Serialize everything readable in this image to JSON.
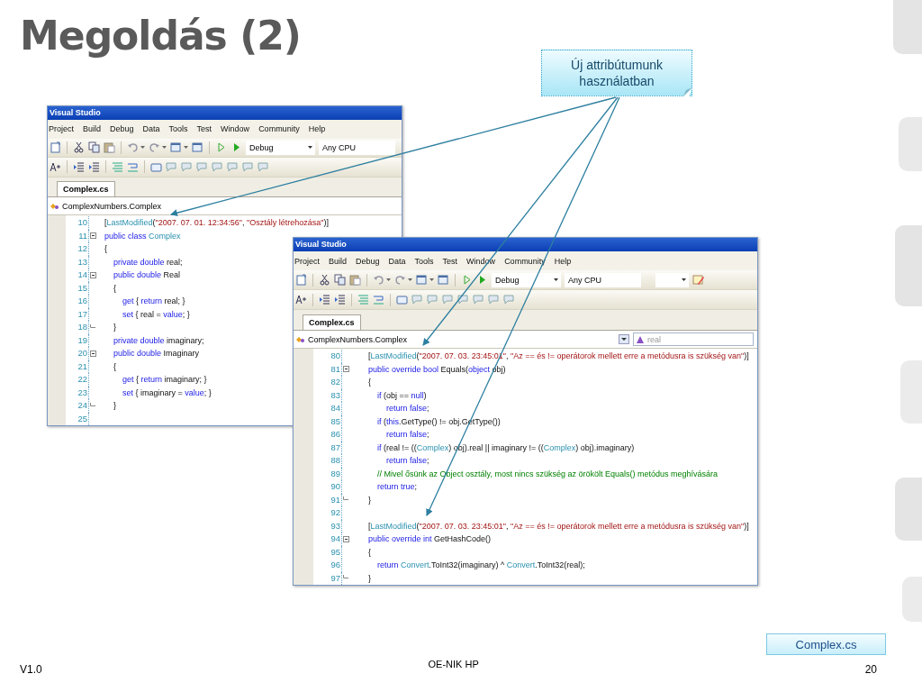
{
  "slide": {
    "title": "Megoldás (2)",
    "callout": "Új attribútumunk használatban"
  },
  "windows": [
    {
      "title": "Visual Studio",
      "menu": [
        "Project",
        "Build",
        "Debug",
        "Data",
        "Tools",
        "Test",
        "Window",
        "Community",
        "Help"
      ],
      "configuration": "Debug",
      "platform": "Any CPU",
      "extra_combo": false,
      "tab": {
        "label": "Complex.cs",
        "selected": true
      },
      "navigation": "ComplexNumbers.Complex",
      "lines": [
        {
          "number": "10",
          "kind": "plain",
          "tokens": [
            {
              "kind": "txt",
              "t": "["
            },
            {
              "kind": "type",
              "t": "LastModified"
            },
            {
              "kind": "txt",
              "t": "("
            },
            {
              "kind": "str",
              "t": "\"2007. 07. 01. 12:34:56\""
            },
            {
              "kind": "txt",
              "t": ", "
            },
            {
              "kind": "str",
              "t": "\"Osztály létrehozása\""
            },
            {
              "kind": "txt",
              "t": ")]"
            }
          ]
        },
        {
          "number": "11",
          "kind": "start",
          "tokens": [
            {
              "kind": "kw",
              "t": "public class "
            },
            {
              "kind": "type",
              "t": "Complex"
            }
          ]
        },
        {
          "number": "12",
          "kind": "plain",
          "tokens": [
            {
              "kind": "txt",
              "t": "{"
            }
          ]
        },
        {
          "number": "13",
          "kind": "plain",
          "tokens": [
            {
              "kind": "kw",
              "t": "    private double "
            },
            {
              "kind": "txt",
              "t": "real;"
            }
          ]
        },
        {
          "number": "14",
          "kind": "start",
          "tokens": [
            {
              "kind": "kw",
              "t": "    public double "
            },
            {
              "kind": "txt",
              "t": "Real"
            }
          ]
        },
        {
          "number": "15",
          "kind": "plain",
          "tokens": [
            {
              "kind": "txt",
              "t": "    {"
            }
          ]
        },
        {
          "number": "16",
          "kind": "plain",
          "tokens": [
            {
              "kind": "kw",
              "t": "        get "
            },
            {
              "kind": "txt",
              "t": "{ "
            },
            {
              "kind": "kw",
              "t": "return "
            },
            {
              "kind": "txt",
              "t": "real; }"
            }
          ]
        },
        {
          "number": "17",
          "kind": "plain",
          "tokens": [
            {
              "kind": "kw",
              "t": "        set "
            },
            {
              "kind": "txt",
              "t": "{ real = "
            },
            {
              "kind": "kw",
              "t": "value"
            },
            {
              "kind": "txt",
              "t": "; }"
            }
          ]
        },
        {
          "number": "18",
          "kind": "end",
          "tokens": [
            {
              "kind": "txt",
              "t": "    }"
            }
          ]
        },
        {
          "number": "19",
          "kind": "plain",
          "tokens": [
            {
              "kind": "kw",
              "t": "    private double "
            },
            {
              "kind": "txt",
              "t": "imaginary;"
            }
          ]
        },
        {
          "number": "20",
          "kind": "start",
          "tokens": [
            {
              "kind": "kw",
              "t": "    public double "
            },
            {
              "kind": "txt",
              "t": "Imaginary"
            }
          ]
        },
        {
          "number": "21",
          "kind": "plain",
          "tokens": [
            {
              "kind": "txt",
              "t": "    {"
            }
          ]
        },
        {
          "number": "22",
          "kind": "plain",
          "tokens": [
            {
              "kind": "kw",
              "t": "        get "
            },
            {
              "kind": "txt",
              "t": "{ "
            },
            {
              "kind": "kw",
              "t": "return "
            },
            {
              "kind": "txt",
              "t": "imaginary; }"
            }
          ]
        },
        {
          "number": "23",
          "kind": "plain",
          "tokens": [
            {
              "kind": "kw",
              "t": "        set "
            },
            {
              "kind": "txt",
              "t": "{ imaginary = "
            },
            {
              "kind": "kw",
              "t": "value"
            },
            {
              "kind": "txt",
              "t": "; }"
            }
          ]
        },
        {
          "number": "24",
          "kind": "end",
          "tokens": [
            {
              "kind": "txt",
              "t": "    }"
            }
          ]
        },
        {
          "number": "25",
          "kind": "plain"
        }
      ]
    },
    {
      "title": "Visual Studio",
      "menu": [
        "Project",
        "Build",
        "Debug",
        "Data",
        "Tools",
        "Test",
        "Window",
        "Community",
        "Help"
      ],
      "configuration": "Debug",
      "platform": "Any CPU",
      "extra_combo": true,
      "tab": {
        "label": "Complex.cs",
        "selected": true
      },
      "navigation": "ComplexNumbers.Complex",
      "member": "real",
      "lines": [
        {
          "number": "80",
          "kind": "plain",
          "tokens": [
            {
              "kind": "txt",
              "t": "["
            },
            {
              "kind": "type",
              "t": "LastModified"
            },
            {
              "kind": "txt",
              "t": "("
            },
            {
              "kind": "str",
              "t": "\"2007. 07. 03. 23:45:01\""
            },
            {
              "kind": "txt",
              "t": ", "
            },
            {
              "kind": "str",
              "t": "\"Az == és != operátorok mellett erre a metódusra is szükség van\""
            },
            {
              "kind": "txt",
              "t": ")]"
            }
          ]
        },
        {
          "number": "81",
          "kind": "start",
          "tokens": [
            {
              "kind": "kw",
              "t": "public override bool "
            },
            {
              "kind": "txt",
              "t": "Equals("
            },
            {
              "kind": "kw",
              "t": "object "
            },
            {
              "kind": "txt",
              "t": "obj)"
            }
          ]
        },
        {
          "number": "82",
          "kind": "plain",
          "tokens": [
            {
              "kind": "txt",
              "t": "{"
            }
          ]
        },
        {
          "number": "83",
          "kind": "plain",
          "tokens": [
            {
              "kind": "kw",
              "t": "    if "
            },
            {
              "kind": "txt",
              "t": "(obj == "
            },
            {
              "kind": "kw",
              "t": "null"
            },
            {
              "kind": "txt",
              "t": ")"
            }
          ]
        },
        {
          "number": "84",
          "kind": "plain",
          "tokens": [
            {
              "kind": "kw",
              "t": "        return false"
            },
            {
              "kind": "txt",
              "t": ";"
            }
          ]
        },
        {
          "number": "85",
          "kind": "plain",
          "tokens": [
            {
              "kind": "kw",
              "t": "    if "
            },
            {
              "kind": "txt",
              "t": "("
            },
            {
              "kind": "kw",
              "t": "this"
            },
            {
              "kind": "txt",
              "t": ".GetType() != obj.GetType())"
            }
          ]
        },
        {
          "number": "86",
          "kind": "plain",
          "tokens": [
            {
              "kind": "kw",
              "t": "        return false"
            },
            {
              "kind": "txt",
              "t": ";"
            }
          ]
        },
        {
          "number": "87",
          "kind": "plain",
          "tokens": [
            {
              "kind": "kw",
              "t": "    if "
            },
            {
              "kind": "txt",
              "t": "(real != (("
            },
            {
              "kind": "type",
              "t": "Complex"
            },
            {
              "kind": "txt",
              "t": ") obj).real || imaginary != (("
            },
            {
              "kind": "type",
              "t": "Complex"
            },
            {
              "kind": "txt",
              "t": ") obj).imaginary)"
            }
          ]
        },
        {
          "number": "88",
          "kind": "plain",
          "tokens": [
            {
              "kind": "kw",
              "t": "        return false"
            },
            {
              "kind": "txt",
              "t": ";"
            }
          ]
        },
        {
          "number": "89",
          "kind": "plain",
          "tokens": [
            {
              "kind": "cmt",
              "t": "    // Mivel ősünk az Object osztály, most nincs szükség az örökölt Equals() metódus meghívására"
            }
          ]
        },
        {
          "number": "90",
          "kind": "plain",
          "tokens": [
            {
              "kind": "kw",
              "t": "    return true"
            },
            {
              "kind": "txt",
              "t": ";"
            }
          ]
        },
        {
          "number": "91",
          "kind": "end",
          "tokens": [
            {
              "kind": "txt",
              "t": "}"
            }
          ]
        },
        {
          "number": "92",
          "kind": "plain"
        },
        {
          "number": "93",
          "kind": "plain",
          "tokens": [
            {
              "kind": "txt",
              "t": "["
            },
            {
              "kind": "type",
              "t": "LastModified"
            },
            {
              "kind": "txt",
              "t": "("
            },
            {
              "kind": "str",
              "t": "\"2007. 07. 03. 23:45:01\""
            },
            {
              "kind": "txt",
              "t": ", "
            },
            {
              "kind": "str",
              "t": "\"Az == és != operátorok mellett erre a metódusra is szükség van\""
            },
            {
              "kind": "txt",
              "t": ")]"
            }
          ]
        },
        {
          "number": "94",
          "kind": "start",
          "tokens": [
            {
              "kind": "kw",
              "t": "public override int "
            },
            {
              "kind": "txt",
              "t": "GetHashCode()"
            }
          ]
        },
        {
          "number": "95",
          "kind": "plain",
          "tokens": [
            {
              "kind": "txt",
              "t": "{"
            }
          ]
        },
        {
          "number": "96",
          "kind": "plain",
          "tokens": [
            {
              "kind": "kw",
              "t": "    return "
            },
            {
              "kind": "type",
              "t": "Convert"
            },
            {
              "kind": "txt",
              "t": ".ToInt32(imaginary) ^ "
            },
            {
              "kind": "type",
              "t": "Convert"
            },
            {
              "kind": "txt",
              "t": ".ToInt32(real);"
            }
          ]
        },
        {
          "number": "97",
          "kind": "end",
          "tokens": [
            {
              "kind": "txt",
              "t": "}"
            }
          ]
        }
      ]
    }
  ],
  "footer": {
    "file": "Complex.cs",
    "version": "V1.0",
    "organization": "OE-NIK HP",
    "page": "20"
  }
}
